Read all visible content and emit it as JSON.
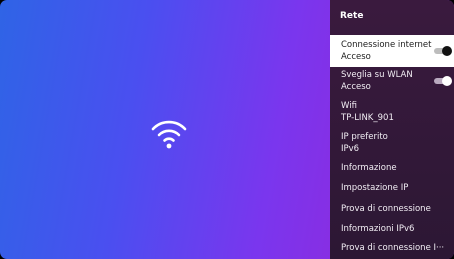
{
  "panel": {
    "title": "Rete",
    "items": [
      {
        "label": "Connessione internet",
        "value": "Acceso",
        "toggle": true,
        "selected": true
      },
      {
        "label": "Sveglia su WLAN",
        "value": "Acceso",
        "toggle": true,
        "selected": false
      },
      {
        "label": "Wifi",
        "value": "TP-LINK_901"
      },
      {
        "label": "IP preferito",
        "value": "IPv6"
      },
      {
        "label": "Informazione"
      },
      {
        "label": "Impostazione IP"
      },
      {
        "label": "Prova di connessione"
      },
      {
        "label": "Informazioni IPv6"
      },
      {
        "label": "Prova di connessione I···"
      }
    ]
  },
  "icons": {
    "hero": "wifi-icon"
  },
  "colors": {
    "gradient_start": "#2f64e6",
    "gradient_end": "#8b2ce0",
    "panel_bg": "#3a1a3e",
    "selected_bg": "#ffffff"
  }
}
